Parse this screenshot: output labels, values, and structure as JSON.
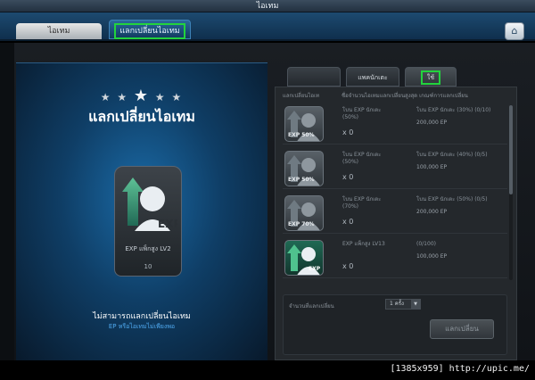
{
  "window": {
    "title": "ไอเทม"
  },
  "tabs": [
    {
      "label": "ไอเทม",
      "active": false
    },
    {
      "label": "แลกเปลี่ยนไอเทม",
      "active": true
    }
  ],
  "left_panel": {
    "title": "แลกเปลี่ยนไอเทม",
    "stars": "★ ★ ★ ★ ★",
    "card": {
      "name": "EXP แพ็กสูง LV2",
      "count": "10",
      "badge": "EXP"
    },
    "warning": "ไม่สามารถแลกเปลี่ยนไอเทม",
    "warning_sub": "EP หรือไอเทมไม่เพียงพอ"
  },
  "right_tabs": [
    {
      "label": ""
    },
    {
      "label": "แพคนักเตะ"
    },
    {
      "label": "ใช้",
      "active": true
    }
  ],
  "columns": {
    "a": "แลกเปลี่ยนไอเท",
    "b": "ชื่อจำนวนไอเทมแลกเปลี่ยนสูงสุด เกณฑ์การแลกเปลี่ยน"
  },
  "rows": [
    {
      "tag": "EXP 50%",
      "name": "โบน EXP นักเตะ\n(50%)",
      "cond": "โบน EXP นักเตะ (30%) (0/10)",
      "price": "200,000 EP",
      "qty": "x 0"
    },
    {
      "tag": "EXP 50%",
      "name": "โบน EXP นักเตะ\n(50%)",
      "cond": "โบน EXP นักเตะ (40%) (0/5)",
      "price": "100,000 EP",
      "qty": "x 0"
    },
    {
      "tag": "EXP 70%",
      "name": "โบน EXP นักเตะ\n(70%)",
      "cond": "โบน EXP นักเตะ (50%) (0/5)",
      "price": "200,000 EP",
      "qty": "x 0"
    },
    {
      "tag": "EXP",
      "name": "EXP แพ็กสูง LV13",
      "cond": "(0/100)",
      "price": "100,000 EP",
      "qty": "x 0"
    }
  ],
  "exchange": {
    "qty_label": "จำนวนที่แลกเปลี่ยน",
    "qty_value": "1 ครั้ง",
    "button": "แลกเปลี่ยน"
  },
  "watermark": "[1385x959] http://upic.me/",
  "colors": {
    "highlight": "#22d33d",
    "accent": "#4fa9ef"
  }
}
